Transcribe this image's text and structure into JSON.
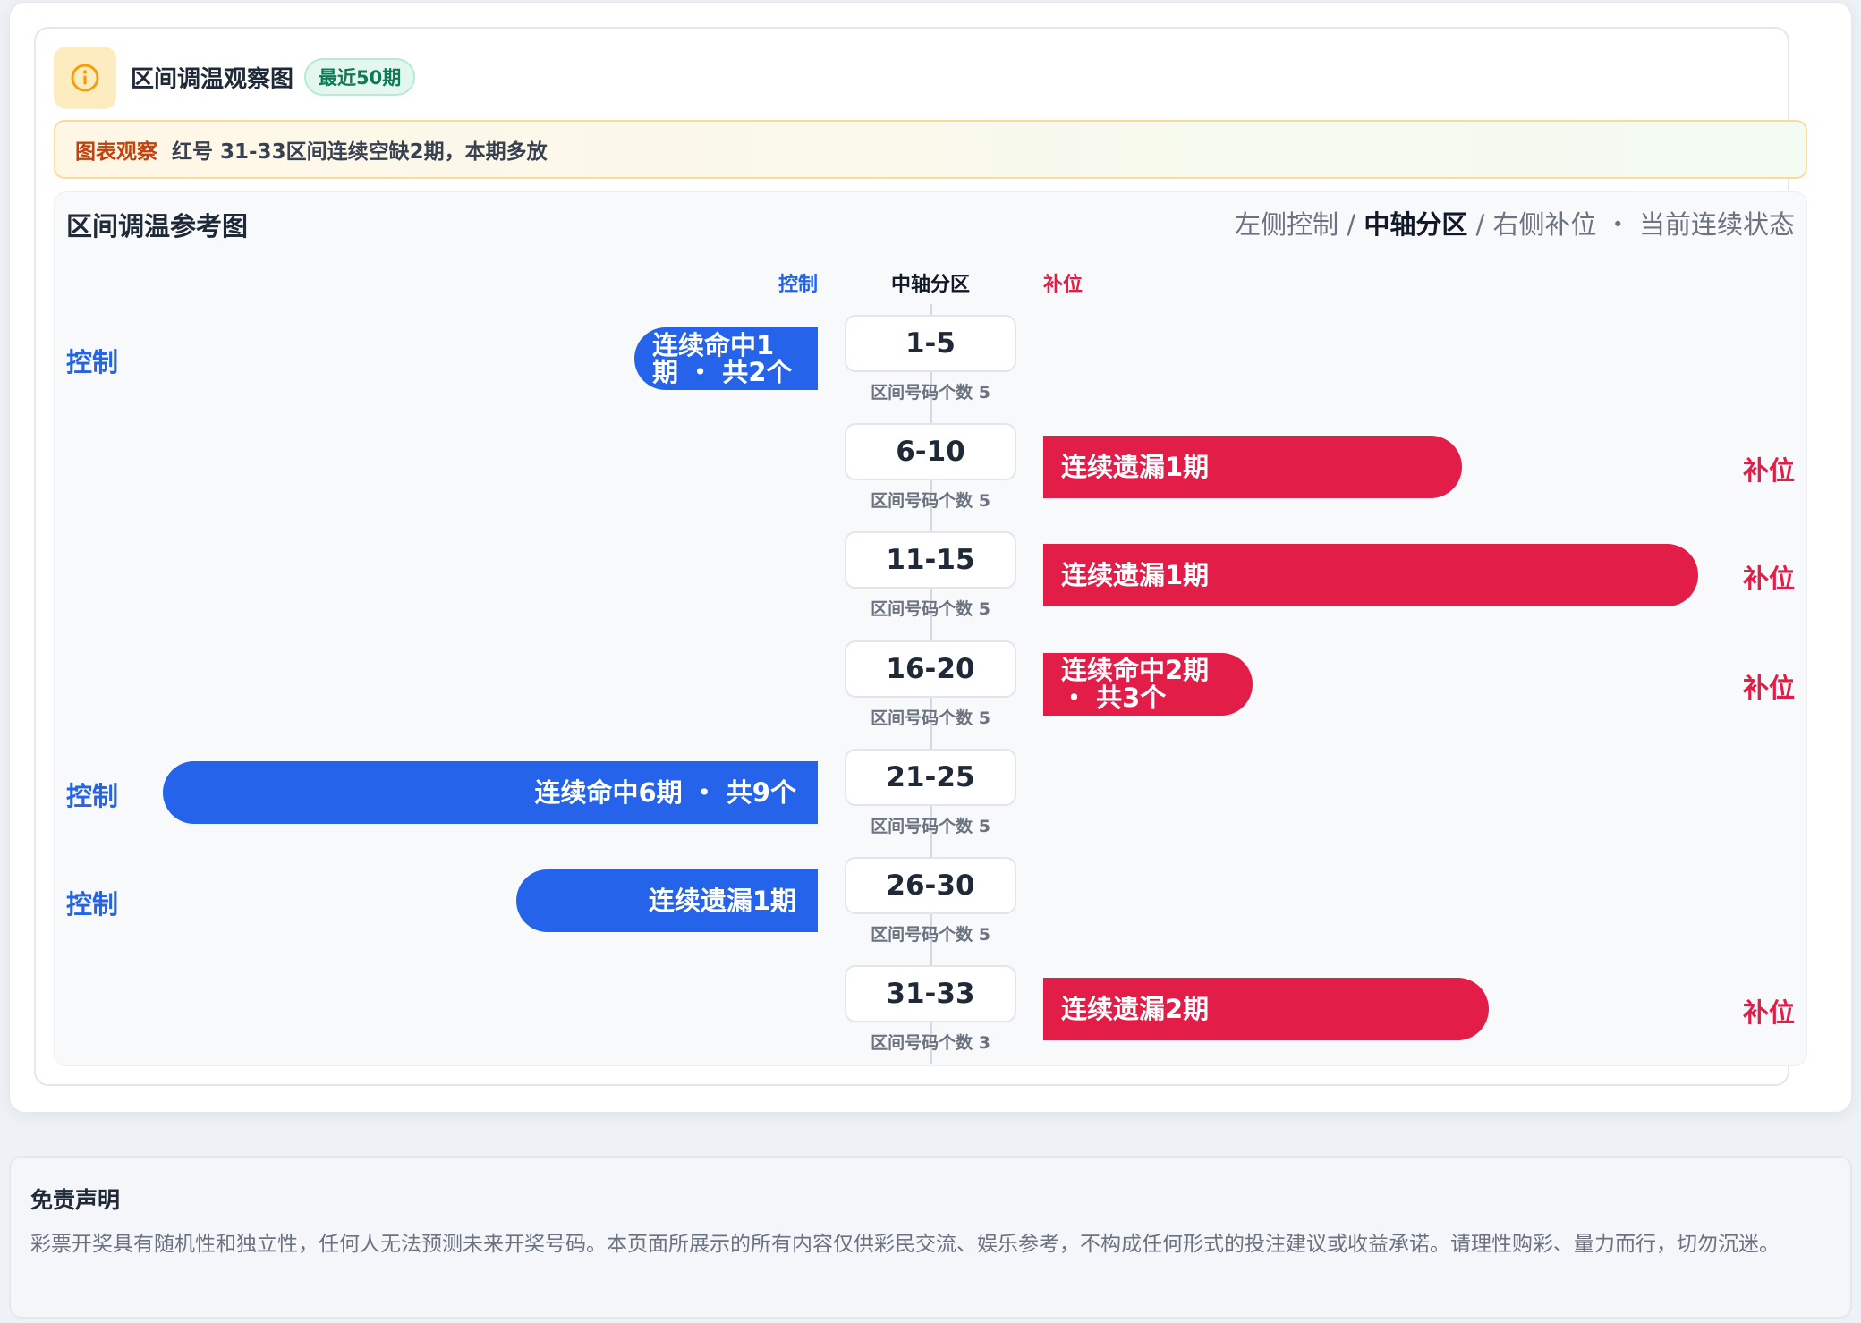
{
  "header": {
    "title": "区间调温观察图",
    "badge": "最近50期",
    "icon": "info-icon",
    "icon_color": "#f59e0b"
  },
  "observation": {
    "label": "图表观察",
    "text": "红号 31-33区间连续空缺2期，本期多放"
  },
  "chart_panel": {
    "title": "区间调温参考图",
    "legend": {
      "part1": "左侧控制 / ",
      "part2": "中轴分区",
      "part3": " / 右侧补位 ・ 当前连续状态"
    },
    "col_heads": {
      "left": "控制",
      "center": "中轴分区",
      "right": "补位"
    },
    "colors": {
      "control": "#2563eb",
      "fill": "#e11d48"
    }
  },
  "chart_data": {
    "type": "bar",
    "categories": [
      "1-5",
      "6-10",
      "11-15",
      "16-20",
      "21-25",
      "26-30",
      "31-33"
    ],
    "zone_sub": [
      "区间号码个数 5",
      "区间号码个数 5",
      "区间号码个数 5",
      "区间号码个数 5",
      "区间号码个数 5",
      "区间号码个数 5",
      "区间号码个数 3"
    ],
    "rows": [
      {
        "zone": "1-5",
        "side": "control",
        "side_label": "控制",
        "bar_label": "连续命中1期 ・ 共2个",
        "magnitude": 0.28
      },
      {
        "zone": "6-10",
        "side": "fill",
        "side_label": "补位",
        "bar_label": "连续遗漏1期",
        "magnitude": 0.64
      },
      {
        "zone": "11-15",
        "side": "fill",
        "side_label": "补位",
        "bar_label": "连续遗漏1期",
        "magnitude": 1.0
      },
      {
        "zone": "16-20",
        "side": "fill",
        "side_label": "补位",
        "bar_label": "连续命中2期 ・ 共3个",
        "magnitude": 0.32
      },
      {
        "zone": "21-25",
        "side": "control",
        "side_label": "控制",
        "bar_label": "连续命中6期 ・ 共9个",
        "magnitude": 1.0
      },
      {
        "zone": "26-30",
        "side": "control",
        "side_label": "控制",
        "bar_label": "连续遗漏1期",
        "magnitude": 0.46
      },
      {
        "zone": "31-33",
        "side": "fill",
        "side_label": "补位",
        "bar_label": "连续遗漏2期",
        "magnitude": 0.68
      }
    ]
  },
  "disclaimer": {
    "title": "免责声明",
    "text": "彩票开奖具有随机性和独立性，任何人无法预测未来开奖号码。本页面所展示的所有内容仅供彩民交流、娱乐参考，不构成任何形式的投注建议或收益承诺。请理性购彩、量力而行，切勿沉迷。"
  }
}
